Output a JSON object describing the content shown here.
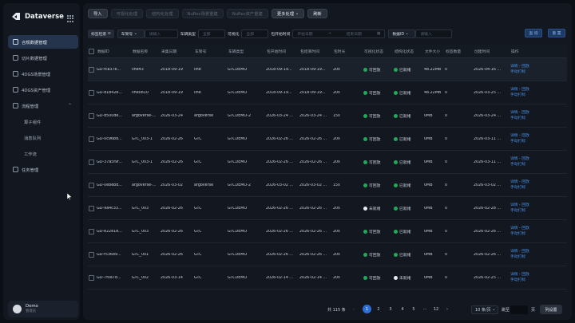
{
  "app": {
    "name": "Dataverse"
  },
  "sidebar": {
    "items": [
      {
        "label": "合规数据管理",
        "icon": "database-icon",
        "active": true
      },
      {
        "label": "切片数据管理",
        "icon": "slice-icon"
      },
      {
        "label": "4DGS场景管理",
        "icon": "scene-icon"
      },
      {
        "label": "4DGS资产管理",
        "icon": "asset-icon"
      },
      {
        "label": "流程管理",
        "icon": "flow-icon",
        "expanded": true
      }
    ],
    "subitems": [
      "算子组件",
      "消息队列",
      "工作流"
    ],
    "last_item": {
      "label": "任务管理",
      "icon": "task-icon"
    },
    "user": {
      "name": "Demo",
      "role": "管理员"
    }
  },
  "toolbar": {
    "buttons": [
      "导入",
      "可视化处理",
      "结构化处理",
      "NuRec场景重建",
      "NuRec资产重建",
      "更多处理",
      "刷新"
    ]
  },
  "filters": {
    "tag_search": "标签检索",
    "model_select": "车架号",
    "model_placeholder": "请输入",
    "vehicle_type_label": "车辆类型",
    "vehicle_type_value": "全部",
    "visual_label": "可视化",
    "visual_value": "全部",
    "time_label": "包开始时间",
    "start_placeholder": "开始日期",
    "end_placeholder": "结束日期",
    "id_select": "数据ID",
    "id_placeholder": "请输入",
    "query_btn": "查 询",
    "reset_btn": "重 置"
  },
  "table": {
    "columns": [
      "数据ID",
      "数据名称",
      "采集日期",
      "车架号",
      "车辆类型",
      "包开始时间",
      "包结束时间",
      "包时长",
      "可视化状态",
      "结构化状态",
      "文件大小",
      "标签数量",
      "创建时间",
      "操作"
    ],
    "rows": [
      [
        "GD-fca37e...",
        "line43",
        "2018-09-19",
        "line",
        "GTCDEMO",
        "2018-09-19...",
        "2018-09-19...",
        "20s",
        "可回放",
        "已就绪",
        "48.22MB",
        "0",
        "2026-04-16 ..."
      ],
      [
        "GD-d1b42e...",
        "line0810",
        "2018-09-19",
        "line",
        "GTCDEMO",
        "2018-09-19...",
        "2018-09-19...",
        "20s",
        "可回放",
        "已就绪",
        "48.22MB",
        "0",
        "2026-03-25 ..."
      ],
      [
        "GD-d500de...",
        "argoverse-...",
        "2026-03-24",
        "argoverse",
        "GTCDEMO-2",
        "2026-03-24 ...",
        "2026-03-24 ...",
        "15s",
        "可回放",
        "已就绪",
        "0MB",
        "0",
        "2026-03-24 ..."
      ],
      [
        "GD-0c96bd...",
        "GTC_003-1",
        "2026-02-26",
        "GTC",
        "GTCDEMO",
        "2026-02-26 ...",
        "2026-02-26 ...",
        "20s",
        "可回放",
        "已就绪",
        "0MB",
        "0",
        "2026-03-11 ..."
      ],
      [
        "GD-37a5f9f...",
        "GTC_003-1",
        "2026-02-26",
        "GTC",
        "GTCDEMO",
        "2026-02-26 ...",
        "2026-02-26 ...",
        "20s",
        "可回放",
        "已就绪",
        "0MB",
        "0",
        "2026-03-11 ..."
      ],
      [
        "GD-0e8ebd...",
        "argoverse-...",
        "2026-03-02",
        "argoverse",
        "GTCDEMO-2",
        "2026-03-02 ...",
        "2026-03-02 ...",
        "15s",
        "可回放",
        "已就绪",
        "0MB",
        "0",
        "2026-03-02 ..."
      ],
      [
        "GD-9a4c33...",
        "GTC_003",
        "2026-02-26",
        "GTC",
        "GTCDEMO",
        "2026-02-26 ...",
        "2026-02-26 ...",
        "20s",
        "未就绪",
        "已就绪",
        "0MB",
        "0",
        "2026-02-28 ..."
      ],
      [
        "GD-e22e1e...",
        "GTC_003",
        "2026-02-26",
        "GTC",
        "GTCDEMO",
        "2026-02-26 ...",
        "2026-02-26 ...",
        "20s",
        "可回放",
        "已就绪",
        "0MB",
        "0",
        "2026-02-26 ..."
      ],
      [
        "GD-f53689...",
        "GTC_001",
        "2026-02-26",
        "GTC",
        "GTCDEMO",
        "2026-02-26 ...",
        "2026-02-26 ...",
        "20s",
        "可回放",
        "已就绪",
        "0MB",
        "0",
        "2026-02-26 ..."
      ],
      [
        "GD-7f0a7d...",
        "GTC_002",
        "2026-03-14",
        "GTC",
        "GTCDEMO",
        "2026-02-14 ...",
        "2026-02-14 ...",
        "20s",
        "可回放",
        "未就绪",
        "0MB",
        "0",
        "2026-02-25 ..."
      ]
    ],
    "ops": [
      "详情",
      "回放",
      "手动打标"
    ]
  },
  "pagination": {
    "total": "共 115 条",
    "pages": [
      "1",
      "2",
      "3",
      "4",
      "5",
      "···",
      "12"
    ],
    "current": "1",
    "size": "10 条/页",
    "jump_label": "跳至",
    "page_suffix": "页",
    "settings": "列设置"
  },
  "colors": {
    "accent": "#2d6fd6",
    "ok": "#1faa5a",
    "link": "#4a8fe8"
  }
}
